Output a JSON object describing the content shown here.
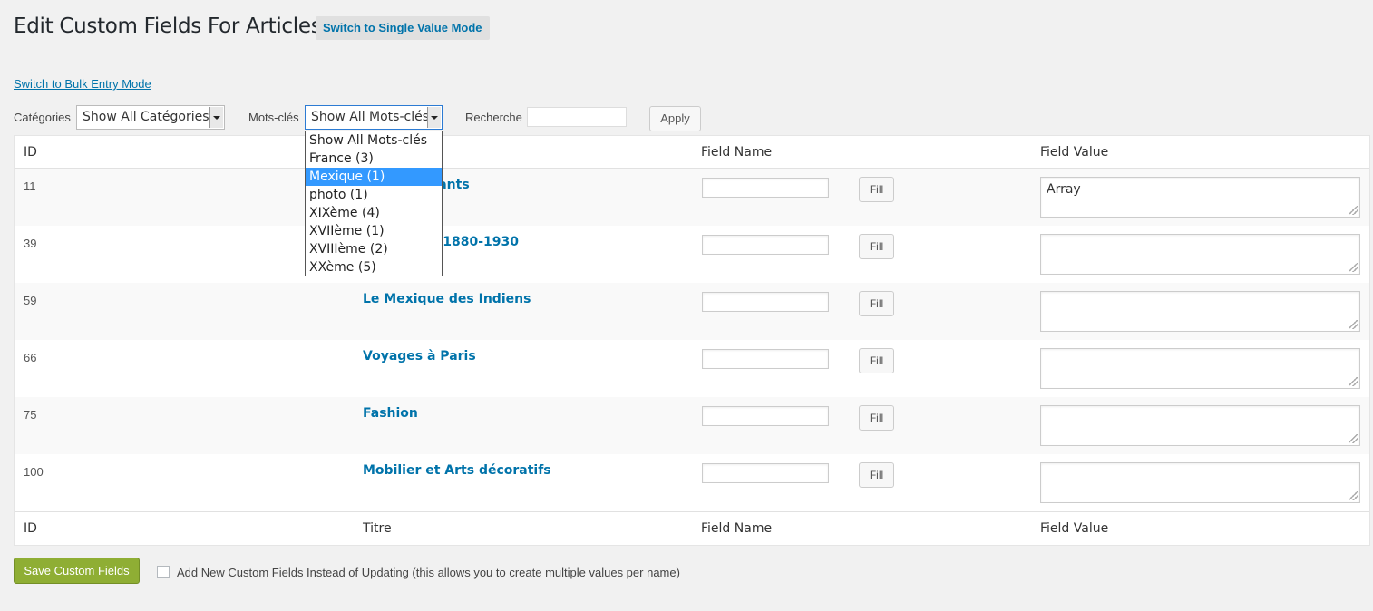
{
  "page": {
    "title": "Edit Custom Fields For Articles",
    "mode_toggle_label": "Switch to Single Value Mode",
    "bulk_link": "Switch to Bulk Entry Mode"
  },
  "filters": {
    "categories_label": "Catégories",
    "categories_value": "Show All Catégories",
    "tags_label": "Mots-clés",
    "tags_value": "Show All Mots-clés",
    "search_label": "Recherche",
    "search_value": "",
    "apply_label": "Apply",
    "tags_options": [
      "Show All Mots-clés",
      "France (3)",
      "Mexique (1)",
      "photo (1)",
      "XIXème (4)",
      "XVIIème (1)",
      "XVIIIème (2)",
      "XXème (5)"
    ],
    "tags_highlighted": "Mexique (1)"
  },
  "table": {
    "headers": {
      "id": "ID",
      "title": "Titre",
      "field_name": "Field Name",
      "field_value": "Field Value"
    },
    "fill_label": "Fill",
    "rows": [
      {
        "id": "11",
        "title": "s d'immigrants",
        "field_name": "",
        "field_value": "Array"
      },
      {
        "id": "39",
        "title": "rs français 1880-1930",
        "field_name": "",
        "field_value": ""
      },
      {
        "id": "59",
        "title": "Le Mexique des Indiens",
        "field_name": "",
        "field_value": ""
      },
      {
        "id": "66",
        "title": "Voyages à Paris",
        "field_name": "",
        "field_value": ""
      },
      {
        "id": "75",
        "title": "Fashion",
        "field_name": "",
        "field_value": ""
      },
      {
        "id": "100",
        "title": "Mobilier et Arts décoratifs",
        "field_name": "",
        "field_value": ""
      }
    ]
  },
  "footer": {
    "save_label": "Save Custom Fields",
    "checkbox_label": "Add New Custom Fields Instead of Updating (this allows you to create multiple values per name)",
    "checkbox_checked": false
  },
  "colors": {
    "link": "#0073aa",
    "save_button": "#8fae34",
    "dropdown_highlight": "#3399ff",
    "background": "#f1f1f1"
  }
}
